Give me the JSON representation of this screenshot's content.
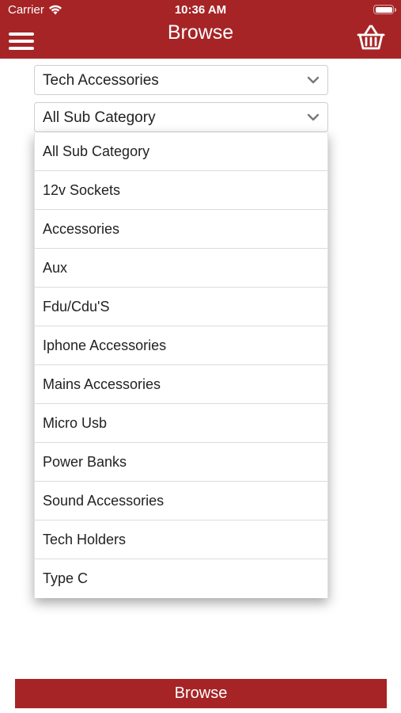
{
  "status_bar": {
    "carrier": "Carrier",
    "time": "10:36 AM"
  },
  "header": {
    "title": "Browse",
    "menu_icon": "hamburger-menu-icon",
    "basket_icon": "shopping-basket-icon"
  },
  "filters": {
    "category": "Tech Accessories",
    "subcategory": "All Sub Category"
  },
  "dropdown": {
    "items": [
      "All Sub Category",
      "12v Sockets",
      "Accessories",
      "Aux",
      "Fdu/Cdu'S",
      "Iphone Accessories",
      "Mains Accessories",
      "Micro Usb",
      "Power Banks",
      "Sound Accessories",
      "Tech Holders",
      "Type C"
    ]
  },
  "footer": {
    "browse_label": "Browse"
  },
  "colors": {
    "brand": "#a62426"
  }
}
